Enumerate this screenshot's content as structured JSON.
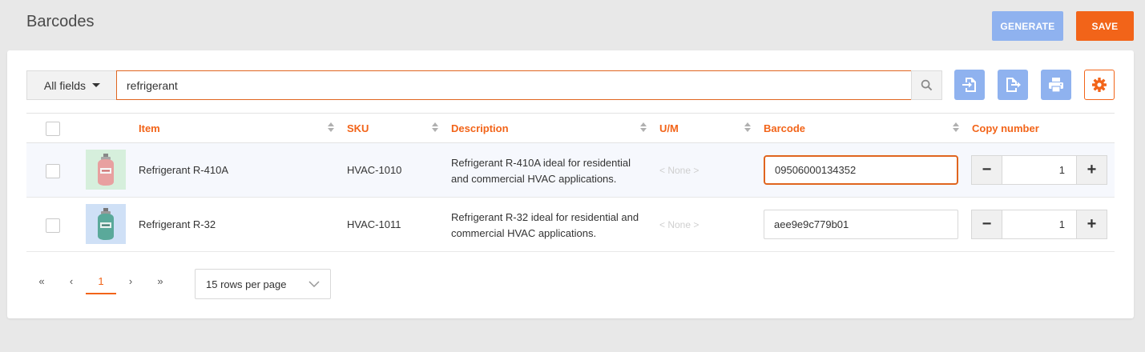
{
  "header": {
    "title": "Barcodes",
    "generate_label": "GENERATE",
    "save_label": "SAVE"
  },
  "search": {
    "field_label": "All fields",
    "value": "refrigerant"
  },
  "toolbar": {
    "icons": [
      "import-icon",
      "export-icon",
      "print-icon",
      "gear-icon"
    ]
  },
  "table": {
    "columns": {
      "item": "Item",
      "sku": "SKU",
      "description": "Description",
      "um": "U/M",
      "barcode": "Barcode",
      "copy": "Copy number"
    },
    "rows": [
      {
        "item": "Refrigerant R-410A",
        "sku": "HVAC-1010",
        "desc_line1": "Refrigerant R-410A ideal for residential",
        "desc_line2": "and commercial HVAC applications.",
        "um": "< None >",
        "barcode": "09506000134352",
        "copies": "1",
        "thumb_color": "#e8a0a0"
      },
      {
        "item": "Refrigerant R-32",
        "sku": "HVAC-1011",
        "desc_line1": "Refrigerant R-32 ideal for residential and",
        "desc_line2": "commercial HVAC applications.",
        "um": "< None >",
        "barcode": "aee9e9c779b01",
        "copies": "1",
        "thumb_color": "#5aa99a"
      }
    ]
  },
  "pagination": {
    "first": "«",
    "prev": "‹",
    "current": "1",
    "next": "›",
    "last": "»",
    "rows_per_page": "15 rows per page"
  },
  "colors": {
    "accent": "#f26419",
    "primary_light": "#8fb2ef"
  }
}
